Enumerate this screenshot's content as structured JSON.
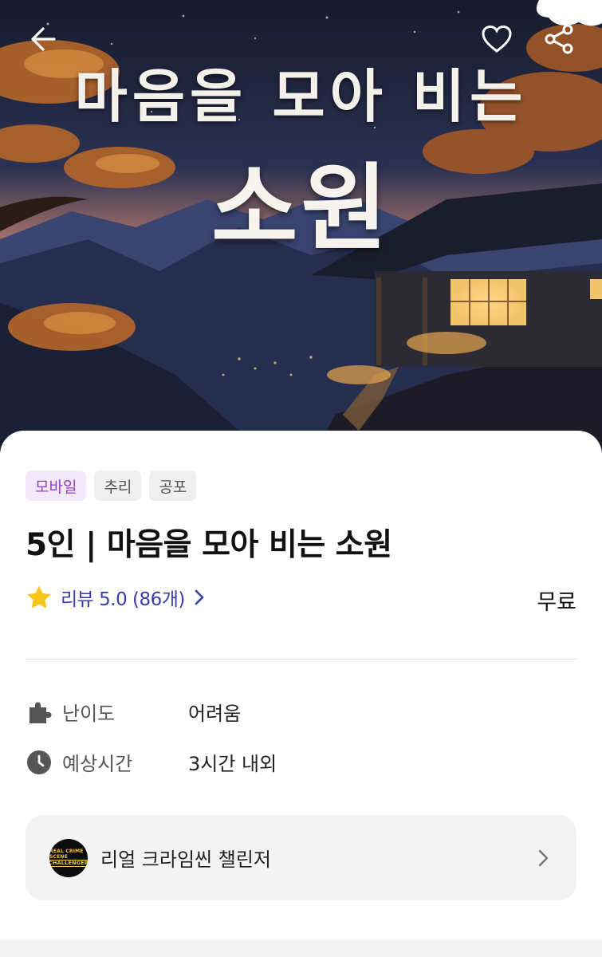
{
  "hero": {
    "title_top": "마음을 모아 비는",
    "title_main": "소원",
    "colors": {
      "sky": "#1c2033",
      "mountain": "#2a3457",
      "dusk": "#b9786a",
      "window_glow": "#f2c46a",
      "leaves": "#c9772f"
    }
  },
  "top_bar": {
    "back_icon": "arrow-left-icon",
    "like_icon": "heart-icon",
    "share_icon": "share-icon"
  },
  "tags": [
    {
      "label": "모바일",
      "type": "platform"
    },
    {
      "label": "추리",
      "type": "genre"
    },
    {
      "label": "공포",
      "type": "genre"
    }
  ],
  "title": "5인 | 마음을 모아 비는 소원",
  "review": {
    "text": "리뷰 5.0 (86개)",
    "rating": 5.0,
    "count": 86,
    "star_color": "#f8c51b",
    "text_color": "#3b3ca8"
  },
  "price": "무료",
  "info": [
    {
      "icon": "puzzle-icon",
      "label": "난이도",
      "value": "어려움"
    },
    {
      "icon": "clock-icon",
      "label": "예상시간",
      "value": "3시간 내외"
    }
  ],
  "challenger": {
    "logo_text_line1": "REAL CRIME SCENE",
    "logo_text_line2": "CHALLENGER",
    "name": "리얼 크라임씬 챌린저"
  }
}
